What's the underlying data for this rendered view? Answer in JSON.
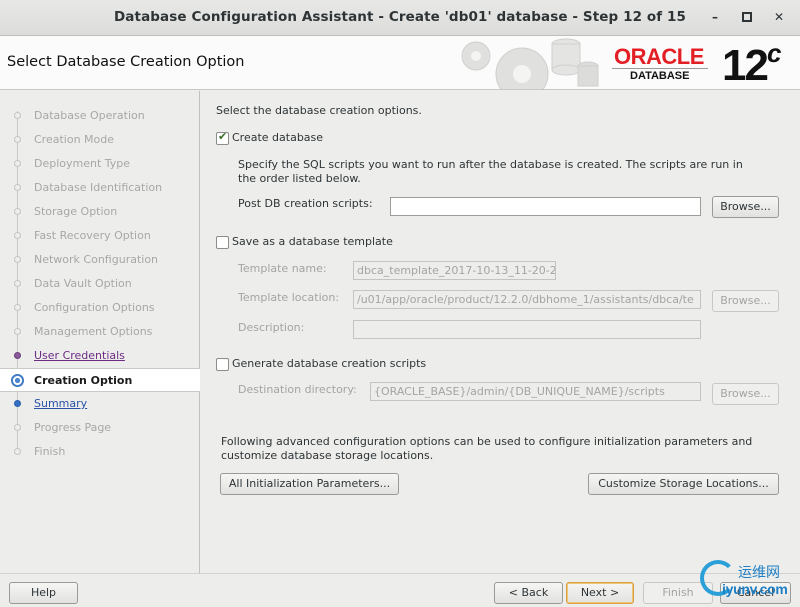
{
  "window": {
    "title": "Database Configuration Assistant - Create 'db01' database - Step 12 of 15"
  },
  "header": {
    "page_title": "Select Database Creation Option",
    "logo_oracle": "ORACLE",
    "logo_database": "DATABASE",
    "version_number": "12",
    "version_suffix": "c"
  },
  "sidebar": {
    "steps": [
      {
        "label": "Database Operation",
        "state": "done"
      },
      {
        "label": "Creation Mode",
        "state": "done"
      },
      {
        "label": "Deployment Type",
        "state": "done"
      },
      {
        "label": "Database Identification",
        "state": "done"
      },
      {
        "label": "Storage Option",
        "state": "done"
      },
      {
        "label": "Fast Recovery Option",
        "state": "done"
      },
      {
        "label": "Network Configuration",
        "state": "done"
      },
      {
        "label": "Data Vault Option",
        "state": "done"
      },
      {
        "label": "Configuration Options",
        "state": "done"
      },
      {
        "label": "Management Options",
        "state": "done"
      },
      {
        "label": "User Credentials",
        "state": "visited"
      },
      {
        "label": "Creation Option",
        "state": "current"
      },
      {
        "label": "Summary",
        "state": "next"
      },
      {
        "label": "Progress Page",
        "state": "pending"
      },
      {
        "label": "Finish",
        "state": "pending"
      }
    ]
  },
  "main": {
    "intro": "Select the database creation options.",
    "create_database": {
      "label": "Create database",
      "checked": true,
      "description_line1": "Specify the SQL scripts you want to run after the database is created. The scripts are run in",
      "description_line2": "the order listed below.",
      "post_scripts_label": "Post DB creation scripts:",
      "post_scripts_value": "",
      "browse_label": "Browse..."
    },
    "save_template": {
      "label": "Save as a database template",
      "checked": false,
      "name_label": "Template name:",
      "name_value": "dbca_template_2017-10-13_11-20-2",
      "location_label": "Template location:",
      "location_value": "/u01/app/oracle/product/12.2.0/dbhome_1/assistants/dbca/te",
      "browse_label": "Browse...",
      "description_label": "Description:",
      "description_value": ""
    },
    "generate_scripts": {
      "label": "Generate database creation scripts",
      "checked": false,
      "destination_label": "Destination directory:",
      "destination_value": "{ORACLE_BASE}/admin/{DB_UNIQUE_NAME}/scripts",
      "browse_label": "Browse..."
    },
    "advanced_text_line1": "Following advanced configuration options can be used to configure initialization parameters and",
    "advanced_text_line2": "customize database storage locations.",
    "init_params_button": "All Initialization Parameters...",
    "storage_locations_button": "Customize Storage Locations..."
  },
  "footer": {
    "help": "Help",
    "back": "< Back",
    "next": "Next >",
    "finish": "Finish",
    "cancel": "Cancel"
  },
  "watermark": {
    "cn": "运维网",
    "en": "iyunv.com"
  },
  "colors": {
    "oracle_red": "#e31f26",
    "visited_step": "#6e2c85",
    "next_step": "#2752a6",
    "current_step_marker": "#4a84cf"
  }
}
